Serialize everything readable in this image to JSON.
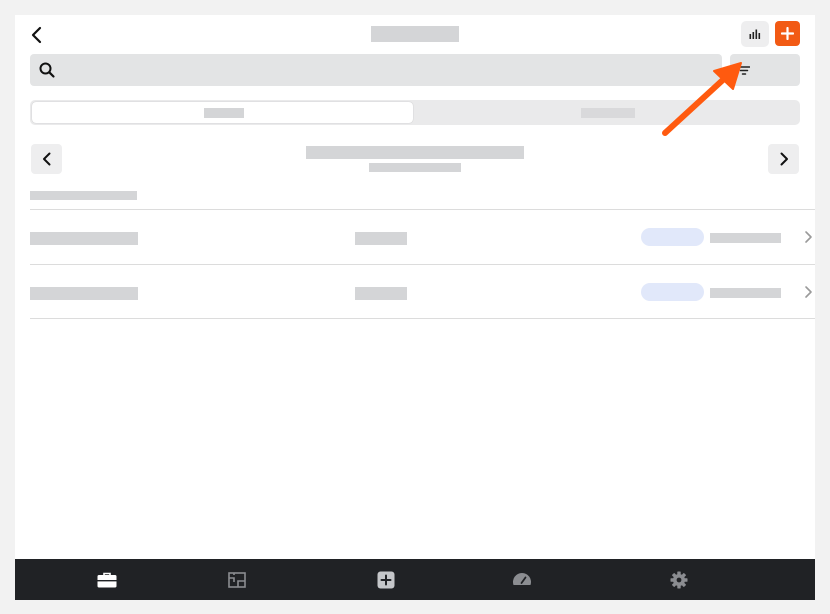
{
  "window": {
    "title": "",
    "chart_icon": "bar-chart-icon",
    "add_icon": "plus-icon",
    "accent_color": "#f25a14"
  },
  "search": {
    "placeholder": "",
    "value": "",
    "icon": "search-icon",
    "filter_icon": "filter-icon"
  },
  "tabs": [
    {
      "label": "",
      "selected": true
    },
    {
      "label": "",
      "selected": false
    }
  ],
  "date_nav": {
    "title": "",
    "subtitle": "",
    "prev_icon": "chevron-left-icon",
    "next_icon": "chevron-right-icon"
  },
  "list": {
    "header": "",
    "rows": [
      {
        "name": "",
        "value": "",
        "status": "",
        "detail": ""
      },
      {
        "name": "",
        "value": "",
        "status": "",
        "detail": ""
      }
    ]
  },
  "bottom_nav": [
    {
      "icon": "briefcase-icon",
      "active": true
    },
    {
      "icon": "floorplan-icon",
      "active": false
    },
    {
      "icon": "plus-square-icon",
      "active": false
    },
    {
      "icon": "speedometer-icon",
      "active": false
    },
    {
      "icon": "gear-icon",
      "active": false
    }
  ],
  "annotation": {
    "color": "#ff5a0f"
  }
}
